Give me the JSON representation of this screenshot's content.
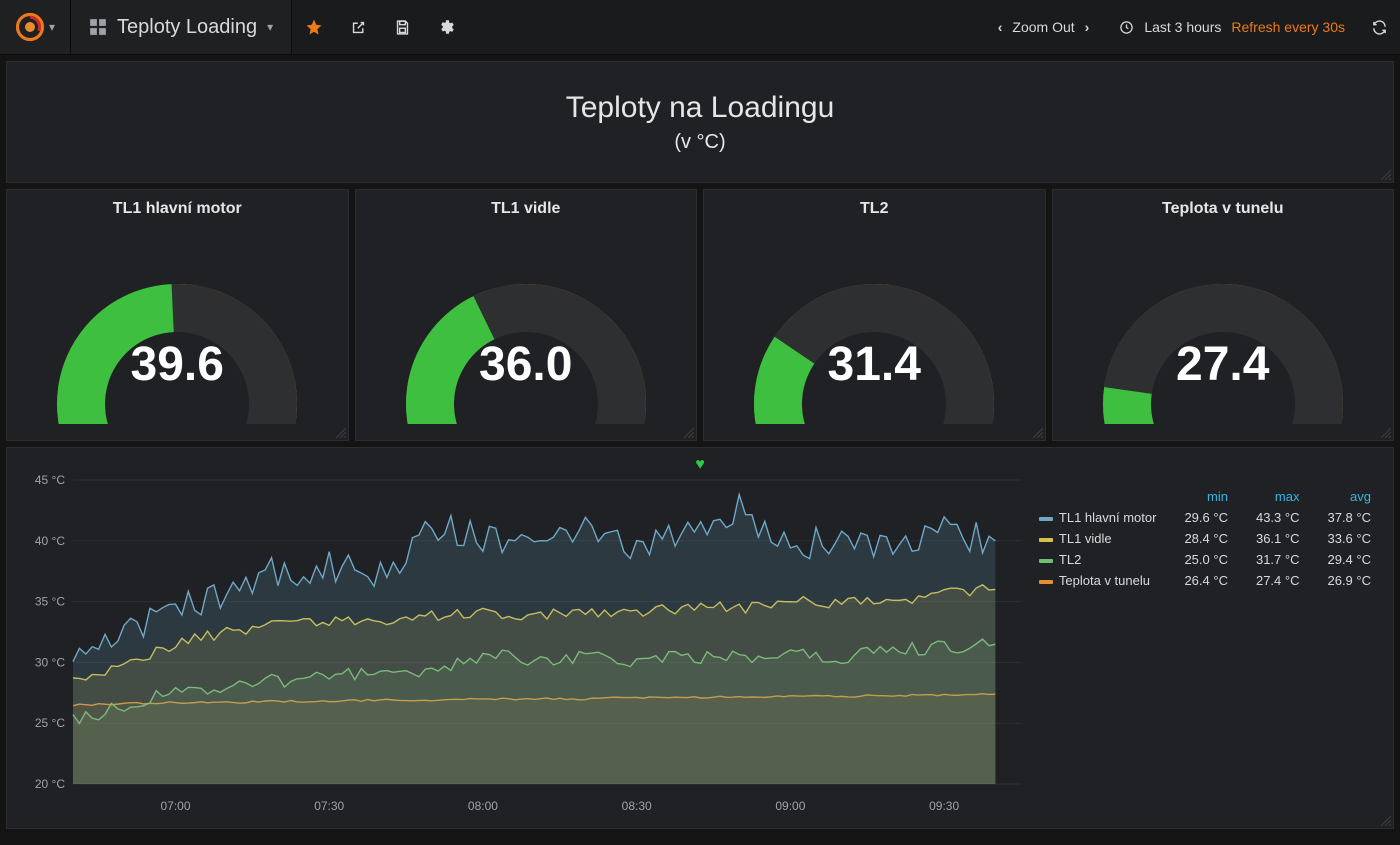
{
  "nav": {
    "dashboard_name": "Teploty Loading",
    "zoom_out": "Zoom Out",
    "time_range": "Last 3 hours",
    "refresh": "Refresh every 30s"
  },
  "header": {
    "title": "Teploty na Loadingu",
    "subtitle": "(v °C)"
  },
  "gauges": [
    {
      "title": "TL1 hlavní motor",
      "value": "39.6",
      "value_num": 39.6,
      "min": 20,
      "max": 60,
      "warn": 40,
      "crit": 55
    },
    {
      "title": "TL1 vidle",
      "value": "36.0",
      "value_num": 36.0,
      "min": 20,
      "max": 60,
      "warn": 40,
      "crit": 55
    },
    {
      "title": "TL2",
      "value": "31.4",
      "value_num": 31.4,
      "min": 20,
      "max": 60,
      "warn": 40,
      "crit": 55
    },
    {
      "title": "Teplota v tunelu",
      "value": "27.4",
      "value_num": 27.4,
      "min": 20,
      "max": 60,
      "warn": 40,
      "crit": 55
    }
  ],
  "chart_data": {
    "type": "line",
    "title": "",
    "ylabel": "",
    "ylim": [
      20,
      45
    ],
    "y_ticks": [
      20,
      25,
      30,
      35,
      40,
      45
    ],
    "y_tick_labels": [
      "20 °C",
      "25 °C",
      "30 °C",
      "35 °C",
      "40 °C",
      "45 °C"
    ],
    "x_ticks": [
      "07:00",
      "07:30",
      "08:00",
      "08:30",
      "09:00",
      "09:30"
    ],
    "x_range_minutes": [
      400,
      585
    ],
    "legend": {
      "headers": [
        "min",
        "max",
        "avg"
      ],
      "rows": [
        {
          "name": "TL1 hlavní motor",
          "color": "#6fa8c7",
          "min": "29.6 °C",
          "max": "43.3 °C",
          "avg": "37.8 °C"
        },
        {
          "name": "TL1 vidle",
          "color": "#d6c24a",
          "min": "28.4 °C",
          "max": "36.1 °C",
          "avg": "33.6 °C"
        },
        {
          "name": "TL2",
          "color": "#6fbf6f",
          "min": "25.0 °C",
          "max": "31.7 °C",
          "avg": "29.4 °C"
        },
        {
          "name": "Teplota v tunelu",
          "color": "#e58f2d",
          "min": "26.4 °C",
          "max": "27.4 °C",
          "avg": "26.9 °C"
        }
      ]
    },
    "series": [
      {
        "name": "TL1 hlavní motor",
        "color": "#6fa8c7",
        "fill": "rgba(111,168,199,0.18)",
        "x": [
          400,
          410,
          420,
          430,
          440,
          450,
          460,
          470,
          480,
          490,
          500,
          510,
          520,
          530,
          540,
          550,
          560,
          570,
          580
        ],
        "y": [
          30.0,
          32.5,
          34.5,
          36.0,
          37.5,
          38.0,
          37.0,
          41.5,
          40.0,
          39.5,
          41.0,
          39.0,
          40.5,
          42.5,
          40.0,
          39.5,
          40.0,
          41.0,
          40.0
        ],
        "noise": 1.4
      },
      {
        "name": "TL1 vidle",
        "color": "#d6c24a",
        "fill": "rgba(214,194,74,0.15)",
        "x": [
          400,
          410,
          420,
          430,
          440,
          450,
          460,
          470,
          480,
          490,
          500,
          510,
          520,
          530,
          540,
          550,
          560,
          570,
          580
        ],
        "y": [
          28.5,
          30.0,
          31.5,
          32.5,
          33.0,
          33.5,
          33.0,
          33.8,
          34.0,
          34.0,
          34.2,
          34.0,
          34.5,
          34.5,
          35.0,
          34.8,
          35.2,
          35.6,
          36.0
        ],
        "noise": 0.5
      },
      {
        "name": "TL2",
        "color": "#6fbf6f",
        "fill": "rgba(111,191,111,0.13)",
        "x": [
          400,
          410,
          420,
          430,
          440,
          450,
          460,
          470,
          480,
          490,
          500,
          510,
          520,
          530,
          540,
          550,
          560,
          570,
          580
        ],
        "y": [
          25.2,
          26.5,
          27.5,
          28.0,
          28.5,
          29.0,
          29.0,
          29.5,
          30.5,
          30.3,
          30.5,
          30.0,
          30.5,
          30.5,
          30.8,
          30.5,
          31.0,
          31.2,
          31.5
        ],
        "noise": 0.6
      },
      {
        "name": "Teplota v tunelu",
        "color": "#e58f2d",
        "fill": "rgba(229,143,45,0.10)",
        "x": [
          400,
          410,
          420,
          430,
          440,
          450,
          460,
          470,
          480,
          490,
          500,
          510,
          520,
          530,
          540,
          550,
          560,
          570,
          580
        ],
        "y": [
          26.5,
          26.6,
          26.7,
          26.7,
          26.8,
          26.8,
          26.9,
          26.9,
          27.0,
          27.0,
          27.0,
          27.1,
          27.1,
          27.2,
          27.2,
          27.2,
          27.3,
          27.3,
          27.4
        ],
        "noise": 0.08
      }
    ]
  }
}
